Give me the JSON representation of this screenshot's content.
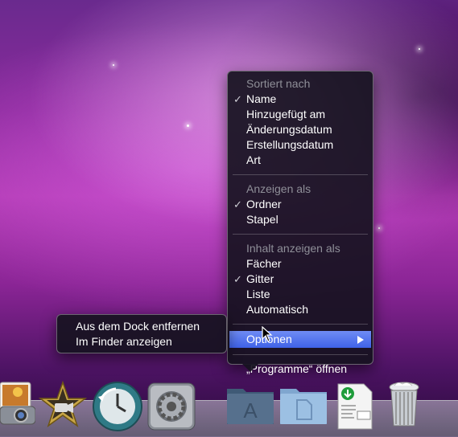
{
  "context_menu": {
    "sections": [
      {
        "header": "Sortiert nach",
        "items": [
          {
            "label": "Name",
            "checked": true
          },
          {
            "label": "Hinzugefügt am",
            "checked": false
          },
          {
            "label": "Änderungsdatum",
            "checked": false
          },
          {
            "label": "Erstellungsdatum",
            "checked": false
          },
          {
            "label": "Art",
            "checked": false
          }
        ]
      },
      {
        "header": "Anzeigen als",
        "items": [
          {
            "label": "Ordner",
            "checked": true
          },
          {
            "label": "Stapel",
            "checked": false
          }
        ]
      },
      {
        "header": "Inhalt anzeigen als",
        "items": [
          {
            "label": "Fächer",
            "checked": false
          },
          {
            "label": "Gitter",
            "checked": true
          },
          {
            "label": "Liste",
            "checked": false
          },
          {
            "label": "Automatisch",
            "checked": false
          }
        ]
      }
    ],
    "options_label": "Optionen",
    "open_label": "„Programme“ öffnen",
    "check_glyph": "✓"
  },
  "submenu": {
    "items": [
      "Aus dem Dock entfernen",
      "Im Finder anzeigen"
    ]
  },
  "dock": {
    "items": [
      "iphoto-icon",
      "imovie-icon",
      "time-machine-icon",
      "system-preferences-icon",
      "applications-folder-icon",
      "documents-folder-icon",
      "pdf-download-icon",
      "trash-icon"
    ]
  },
  "colors": {
    "menu_bg": "#16121f",
    "selection": "#4a6cf0",
    "header_text": "#8f8f98",
    "wallpaper_accent": "#b13ab3"
  }
}
